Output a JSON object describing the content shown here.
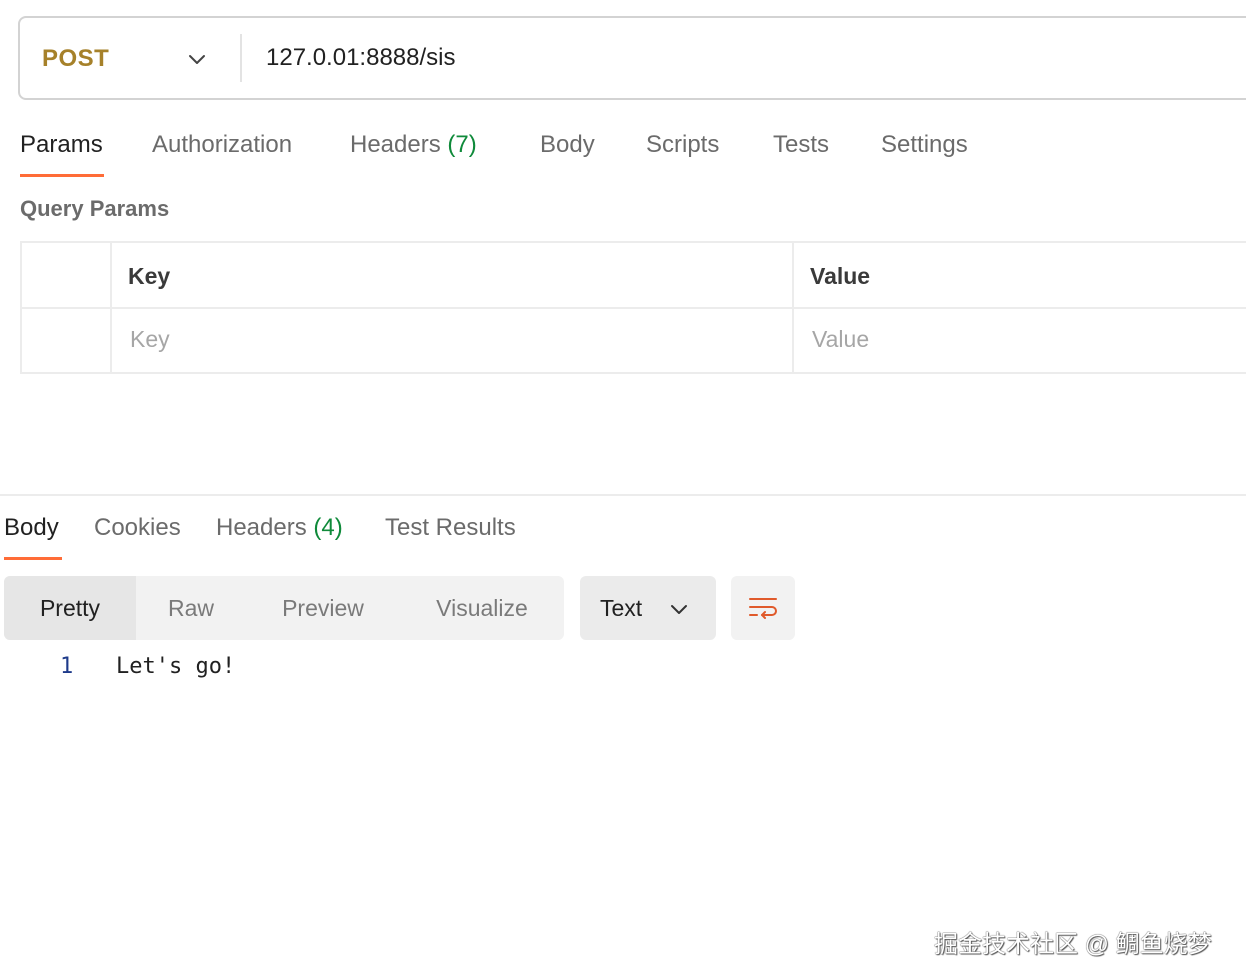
{
  "request": {
    "method": "POST",
    "url": "127.0.01:8888/sis",
    "tabs": [
      {
        "label": "Params"
      },
      {
        "label": "Authorization"
      },
      {
        "label": "Headers",
        "count": "(7)"
      },
      {
        "label": "Body"
      },
      {
        "label": "Scripts"
      },
      {
        "label": "Tests"
      },
      {
        "label": "Settings"
      }
    ],
    "active_tab": "Params",
    "section_title": "Query Params",
    "params_table": {
      "headers": {
        "key": "Key",
        "value": "Value"
      },
      "placeholders": {
        "key": "Key",
        "value": "Value"
      }
    }
  },
  "response": {
    "tabs": [
      {
        "label": "Body"
      },
      {
        "label": "Cookies"
      },
      {
        "label": "Headers",
        "count": "(4)"
      },
      {
        "label": "Test Results"
      }
    ],
    "active_tab": "Body",
    "format_options": [
      "Pretty",
      "Raw",
      "Preview",
      "Visualize"
    ],
    "active_format": "Pretty",
    "content_type": "Text",
    "code_lines": [
      {
        "number": "1",
        "text": "Let's go!"
      }
    ]
  },
  "icons": {
    "method_dropdown": "chevron-down-icon",
    "type_dropdown": "chevron-down-icon",
    "wrap": "word-wrap-icon"
  },
  "colors": {
    "method": "#a6812a",
    "accent": "#ff6c37",
    "count": "#0f8a3a",
    "line_number": "#1e3a8a"
  },
  "watermark": "掘金技术社区 @ 鲷鱼烧梦"
}
